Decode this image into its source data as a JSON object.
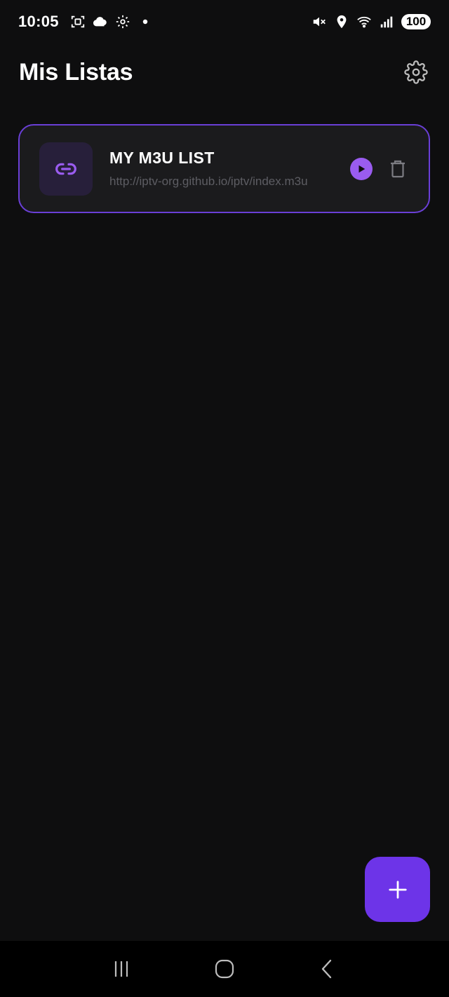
{
  "status_bar": {
    "time": "10:05",
    "battery": "100",
    "icons_left": [
      "screenshot-icon",
      "cloud-icon",
      "gear-icon",
      "dot-icon"
    ],
    "icons_right": [
      "mute-icon",
      "location-icon",
      "wifi-icon",
      "signal-icon"
    ]
  },
  "header": {
    "title": "Mis Listas",
    "settings_icon": "gear-icon"
  },
  "lists": [
    {
      "name": "MY M3U LIST",
      "url": "http://iptv-org.github.io/iptv/index.m3u",
      "icon": "link-icon"
    }
  ],
  "fab": {
    "icon": "plus-icon"
  },
  "nav_bar": {
    "icons": [
      "recent-apps-icon",
      "home-icon",
      "back-icon"
    ]
  },
  "colors": {
    "background": "#0e0e0f",
    "card_background": "#1b1b1d",
    "accent": "#6d34e8",
    "accent_light": "#9a5cf0",
    "card_border": "#6a3fd6",
    "muted_text": "#5d5d63"
  }
}
